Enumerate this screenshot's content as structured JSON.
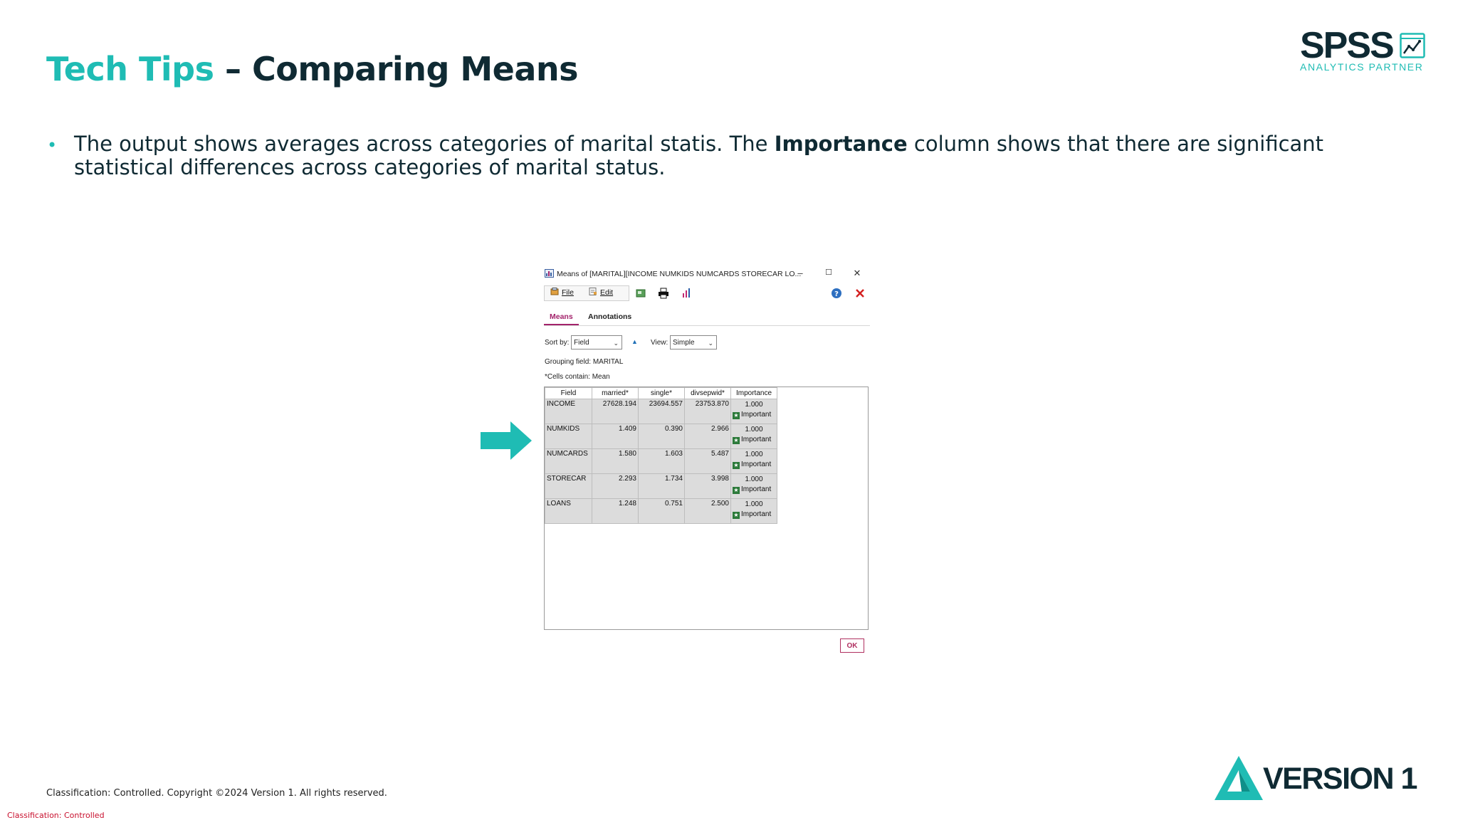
{
  "slide": {
    "title_accent": "Tech Tips",
    "title_rest": " – Comparing Means",
    "bullet": {
      "part1": "The output shows averages across categories of marital statis. The ",
      "bold": "Importance",
      "part2": " column shows that there are significant statistical differences across categories of marital status."
    }
  },
  "branding": {
    "spss_word": "SPSS",
    "spss_sub": "ANALYTICS PARTNER",
    "version1_word": "VERSION 1",
    "accent_color": "#1fbcb4",
    "dark_color": "#0f2a33"
  },
  "dialog": {
    "title": "Means of [MARITAL][INCOME NUMKIDS NUMCARDS STORECAR LO...",
    "window_controls": {
      "minimize": "–",
      "maximize": "☐",
      "close": "✕"
    },
    "toolbar": {
      "file": "File",
      "edit": "Edit"
    },
    "tabs": {
      "means": "Means",
      "annotations": "Annotations"
    },
    "sort_by_label": "Sort by:",
    "sort_by_value": "Field",
    "view_label": "View:",
    "view_value": "Simple",
    "grouping_field": "Grouping field: MARITAL",
    "cells_contain": "*Cells contain: Mean",
    "table": {
      "headers": [
        "Field",
        "married*",
        "single*",
        "divsepwid*",
        "Importance"
      ],
      "rows": [
        {
          "field": "INCOME",
          "married": "27628.194",
          "single": "23694.557",
          "divsepwid": "23753.870",
          "importance": "1.000",
          "importance_label": "Important"
        },
        {
          "field": "NUMKIDS",
          "married": "1.409",
          "single": "0.390",
          "divsepwid": "2.966",
          "importance": "1.000",
          "importance_label": "Important"
        },
        {
          "field": "NUMCARDS",
          "married": "1.580",
          "single": "1.603",
          "divsepwid": "5.487",
          "importance": "1.000",
          "importance_label": "Important"
        },
        {
          "field": "STORECAR",
          "married": "2.293",
          "single": "1.734",
          "divsepwid": "3.998",
          "importance": "1.000",
          "importance_label": "Important"
        },
        {
          "field": "LOANS",
          "married": "1.248",
          "single": "0.751",
          "divsepwid": "2.500",
          "importance": "1.000",
          "importance_label": "Important"
        }
      ]
    },
    "ok_label": "OK"
  },
  "footer": {
    "copyright": "Classification: Controlled. Copyright ©2024 Version 1. All rights reserved.",
    "classification": "Classification: Controlled"
  }
}
